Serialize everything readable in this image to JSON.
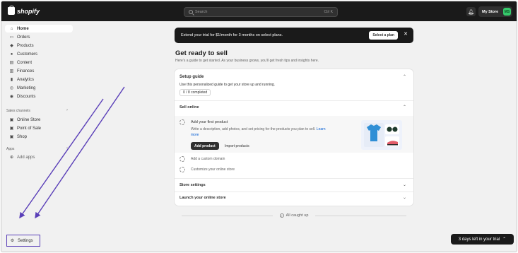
{
  "topbar": {
    "brand": "shopify",
    "search_placeholder": "Search",
    "search_shortcut": "Ctrl K",
    "store_name": "My Store",
    "store_initials": "MS"
  },
  "sidebar": {
    "items": [
      {
        "label": "Home",
        "icon": "home-icon",
        "glyph": "⌂"
      },
      {
        "label": "Orders",
        "icon": "inbox-icon",
        "glyph": "▭"
      },
      {
        "label": "Products",
        "icon": "tag-icon",
        "glyph": "◆"
      },
      {
        "label": "Customers",
        "icon": "person-icon",
        "glyph": "●"
      },
      {
        "label": "Content",
        "icon": "content-icon",
        "glyph": "▤"
      },
      {
        "label": "Finances",
        "icon": "bank-icon",
        "glyph": "▥"
      },
      {
        "label": "Analytics",
        "icon": "bar-chart-icon",
        "glyph": "▮"
      },
      {
        "label": "Marketing",
        "icon": "target-icon",
        "glyph": "◎"
      },
      {
        "label": "Discounts",
        "icon": "discount-icon",
        "glyph": "◉"
      }
    ],
    "sales_channels_label": "Sales channels",
    "channels": [
      {
        "label": "Online Store",
        "icon": "store-icon",
        "glyph": "▣"
      },
      {
        "label": "Point of Sale",
        "icon": "pos-icon",
        "glyph": "▣"
      },
      {
        "label": "Shop",
        "icon": "shop-icon",
        "glyph": "▣"
      }
    ],
    "apps_label": "Apps",
    "add_apps_label": "Add apps",
    "settings_label": "Settings"
  },
  "banner": {
    "text": "Extend your trial for $1/month for 3 months on select plans.",
    "button_label": "Select a plan"
  },
  "main": {
    "title": "Get ready to sell",
    "subtitle": "Here’s a guide to get started. As your business grows, you’ll get fresh tips and insights here."
  },
  "guide": {
    "title": "Setup guide",
    "description": "Use this personalized guide to get your store up and running.",
    "progress_text": "0 / 8 completed",
    "sell_online_title": "Sell online",
    "first_task_title": "Add your first product",
    "first_task_desc": "Write a description, add photos, and set pricing for the products you plan to sell.",
    "learn_more": "Learn more",
    "add_product_label": "Add product",
    "import_label": "Import products",
    "task_custom_domain": "Add a custom domain",
    "task_customize": "Customize your online store",
    "store_settings": "Store settings",
    "launch_store": "Launch your online store"
  },
  "footer": {
    "all_caught_up": "All caught up",
    "trial_days": "3 days left in your trial"
  },
  "colors": {
    "accent_purple": "#5a3fb8",
    "topbar_bg": "#1a1a1a",
    "store_avatar": "#36c96b",
    "link": "#005bd3"
  }
}
